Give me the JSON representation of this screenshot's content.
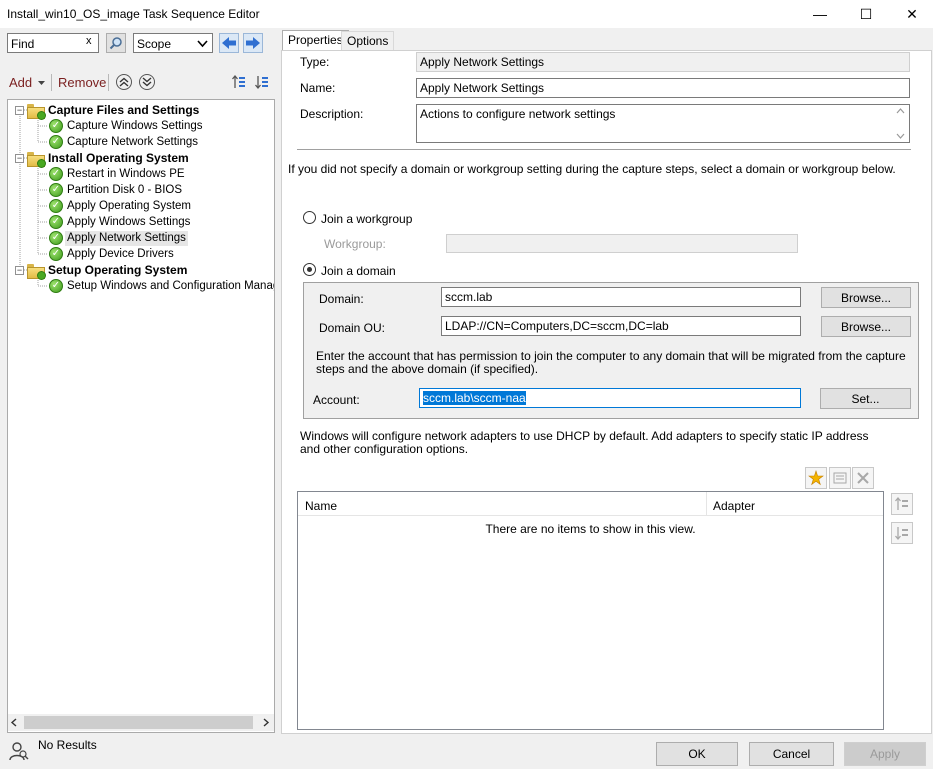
{
  "window": {
    "title": "Install_win10_OS_image Task Sequence Editor",
    "minimize_glyph": "—",
    "maximize_glyph": "☐",
    "close_glyph": "✕"
  },
  "toolbar": {
    "find_value": "Find",
    "find_clear": "x",
    "scope_value": "Scope",
    "add_label": "Add",
    "remove_label": "Remove"
  },
  "tree": {
    "groups": [
      {
        "label": "Capture Files and Settings",
        "items": [
          "Capture Windows Settings",
          "Capture Network Settings"
        ]
      },
      {
        "label": "Install Operating System",
        "items": [
          "Restart in Windows PE",
          "Partition Disk 0 - BIOS",
          "Apply Operating System",
          "Apply Windows Settings",
          "Apply Network Settings",
          "Apply Device Drivers"
        ]
      },
      {
        "label": "Setup Operating System",
        "items": [
          "Setup Windows and Configuration Manager"
        ]
      }
    ],
    "selected": "Apply Network Settings",
    "status": "No Results"
  },
  "tabs": [
    "Properties",
    "Options"
  ],
  "properties": {
    "type_label": "Type:",
    "type_value": "Apply Network Settings",
    "name_label": "Name:",
    "name_value": "Apply Network Settings",
    "description_label": "Description:",
    "description_value": "Actions to configure network settings",
    "info_text": "If you did not specify a domain or workgroup setting during the capture steps, select a domain or workgroup below.",
    "join_workgroup_label": "Join a workgroup",
    "workgroup_label": "Workgroup:",
    "workgroup_value": "",
    "join_domain_label": "Join a domain",
    "domain_label": "Domain:",
    "domain_value": "sccm.lab",
    "domain_ou_label": "Domain OU:",
    "domain_ou_value": "LDAP://CN=Computers,DC=sccm,DC=lab",
    "browse_label": "Browse...",
    "account_info": "Enter the account that has permission to join the computer to any domain that will be migrated from the capture steps and the above domain (if specified).",
    "account_label": "Account:",
    "account_value": "sccm.lab\\sccm-naa",
    "set_label": "Set...",
    "adapters_info": "Windows will configure network adapters to use DHCP by default. Add adapters to specify static IP address and other configuration options.",
    "columns": [
      "Name",
      "Adapter"
    ],
    "empty_text": "There are no items to show in this view."
  },
  "buttons": {
    "ok": "OK",
    "cancel": "Cancel",
    "apply": "Apply"
  },
  "colors": {
    "selection": "#0078d7",
    "arrow_blue": "#2f6fd1",
    "check_green": "#3c9a1a"
  }
}
